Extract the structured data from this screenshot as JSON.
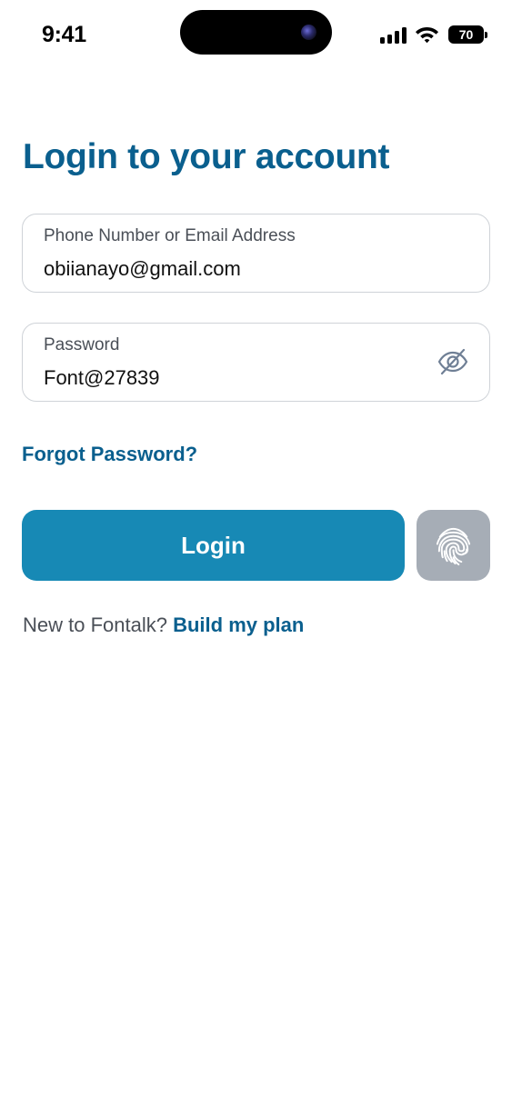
{
  "status_bar": {
    "time": "9:41",
    "battery_level": "70",
    "icons": [
      "signal-bars-icon",
      "wifi-icon",
      "battery-icon"
    ]
  },
  "login": {
    "title": "Login to your account",
    "email_field": {
      "label": "Phone Number or Email Address",
      "value": "obiianayo@gmail.com"
    },
    "password_field": {
      "label": "Password",
      "value": "Font@27839",
      "toggle_icon": "eye-off-icon"
    },
    "forgot_password": "Forgot Password?",
    "login_button": "Login",
    "biometric_icon": "fingerprint-icon",
    "signup_prompt": "New to Fontalk?",
    "signup_link": "Build my plan"
  },
  "colors": {
    "title": "#0a5f8e",
    "link": "#0a5f8e",
    "primary_button": "#1789b5",
    "biometric_button": "#a6adb6",
    "field_border": "#cfd3d8",
    "secondary_text": "#4a4f57"
  }
}
